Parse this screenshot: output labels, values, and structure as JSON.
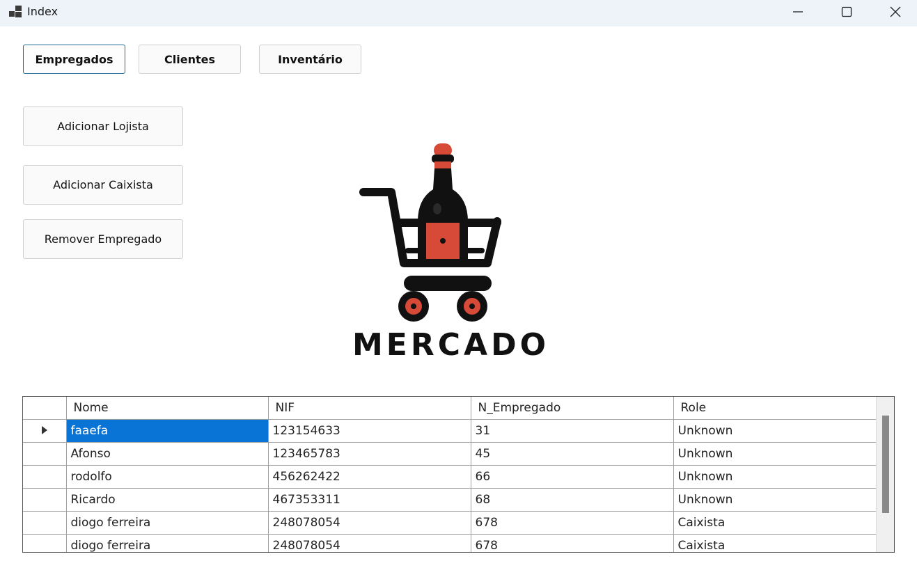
{
  "window": {
    "title": "Index",
    "controls": {
      "minimize": "minimize-icon",
      "maximize": "maximize-icon",
      "close": "close-icon"
    }
  },
  "nav_tabs": [
    {
      "label": "Empregados",
      "active": true
    },
    {
      "label": "Clientes",
      "active": false
    },
    {
      "label": "Inventário",
      "active": false
    }
  ],
  "actions": {
    "add_shopkeeper": "Adicionar Lojista",
    "add_cashier": "Adicionar Caixista",
    "remove_employee": "Remover Empregado"
  },
  "logo": {
    "text": "MERCADO",
    "accent_color": "#d84a38",
    "dark_color": "#111111"
  },
  "table": {
    "columns": [
      "Nome",
      "NIF",
      "N_Empregado",
      "Role"
    ],
    "rows": [
      [
        "faaefa",
        "123154633",
        "31",
        "Unknown"
      ],
      [
        "Afonso",
        "123465783",
        "45",
        "Unknown"
      ],
      [
        "rodolfo",
        "456262422",
        "66",
        "Unknown"
      ],
      [
        "Ricardo",
        "467353311",
        "68",
        "Unknown"
      ],
      [
        "diogo ferreira",
        "248078054",
        "678",
        "Caixista"
      ],
      [
        "diogo ferreira",
        "248078054",
        "678",
        "Caixista"
      ]
    ],
    "selected_row": 0,
    "selected_color": "#0a74d6"
  }
}
